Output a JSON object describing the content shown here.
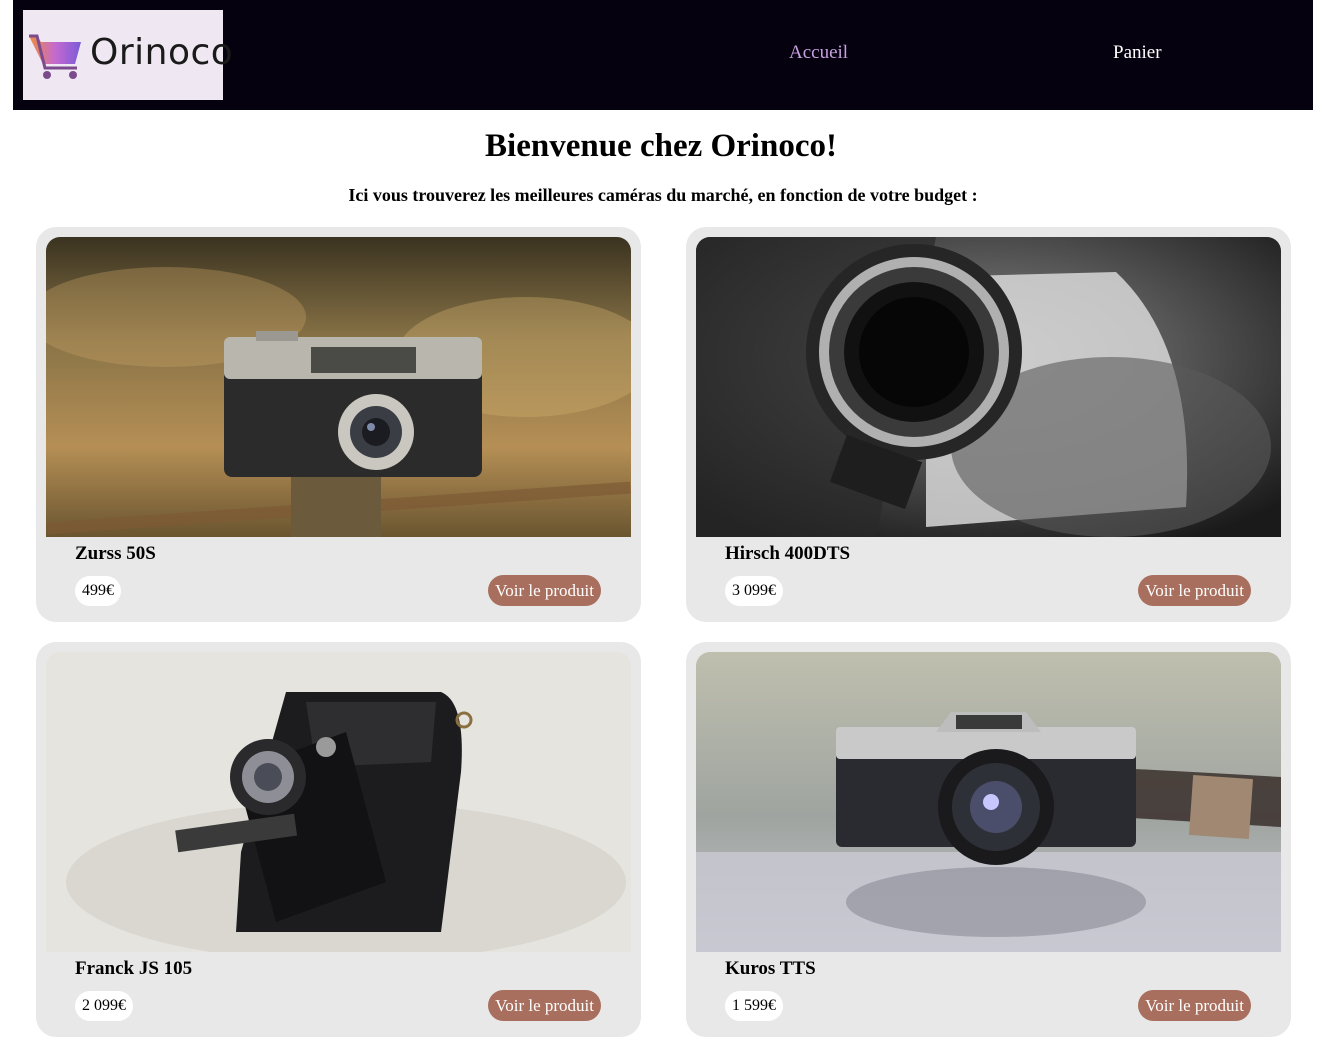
{
  "header": {
    "logo_text": "Orinoco",
    "nav": [
      {
        "label": "Accueil"
      },
      {
        "label": "Panier"
      }
    ]
  },
  "main": {
    "title": "Bienvenue chez Orinoco!",
    "subtitle": "Ici vous trouverez les meilleures caméras du marché, en fonction de votre budget :"
  },
  "products": [
    {
      "name": "Zurss 50S",
      "price": "499€",
      "button_label": "Voir le produit"
    },
    {
      "name": "Hirsch 400DTS",
      "price": "3 099€",
      "button_label": "Voir le produit"
    },
    {
      "name": "Franck JS 105",
      "price": "2 099€",
      "button_label": "Voir le produit"
    },
    {
      "name": "Kuros TTS",
      "price": "1 599€",
      "button_label": "Voir le produit"
    }
  ],
  "colors": {
    "header_bg": "#05010f",
    "nav_active": "#c7a0e0",
    "button_bg": "#a86f5e",
    "card_bg": "#e8e8e8"
  },
  "icons": [
    "shopping-cart-icon"
  ]
}
